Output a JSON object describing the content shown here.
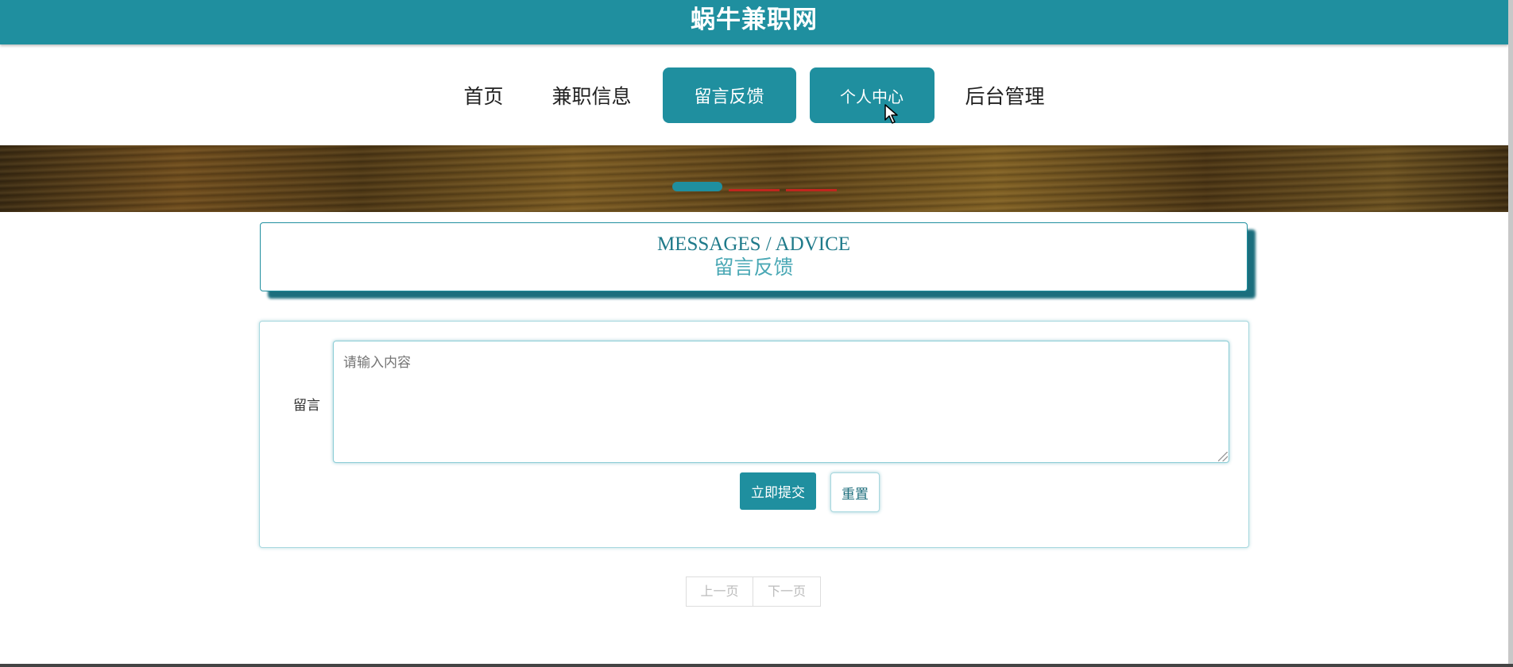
{
  "header": {
    "site_title": "蜗牛兼职网"
  },
  "nav": {
    "items": [
      {
        "label": "首页"
      },
      {
        "label": "兼职信息"
      },
      {
        "label": "留言反馈"
      },
      {
        "label": "个人中心"
      },
      {
        "label": "后台管理"
      }
    ],
    "active_index": 2,
    "hover_index": 3
  },
  "banner": {
    "slide_count": 3,
    "active_slide": 1
  },
  "section": {
    "title_en": "MESSAGES / ADVICE",
    "title_cn": "留言反馈"
  },
  "form": {
    "message_label": "留言",
    "message_value": "",
    "message_placeholder": "请输入内容",
    "submit_label": "立即提交",
    "reset_label": "重置"
  },
  "pager": {
    "prev_label": "上一页",
    "next_label": "下一页"
  },
  "colors": {
    "accent": "#1f8f9f",
    "dot_inactive": "#c0261e"
  }
}
